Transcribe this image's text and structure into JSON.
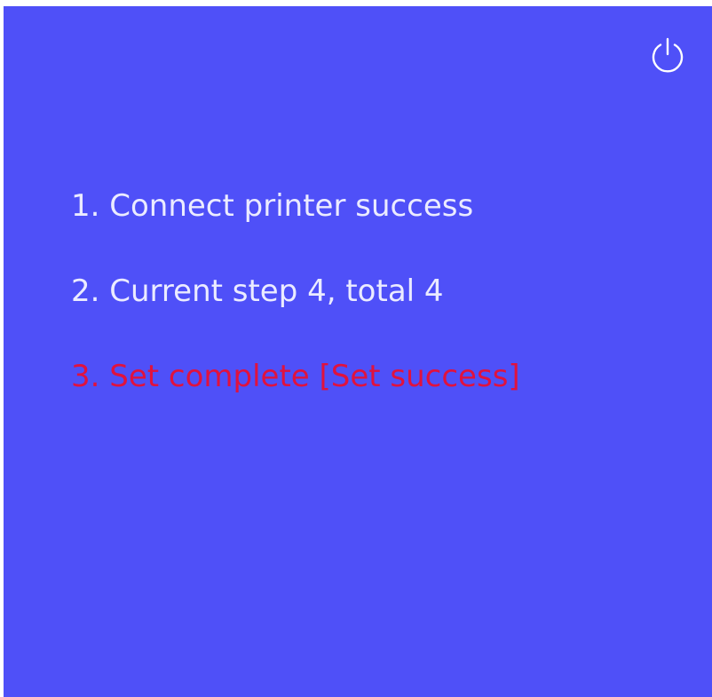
{
  "power_button": {
    "icon": "power-icon",
    "color": "#ffffff"
  },
  "steps": [
    {
      "text": "1. Connect printer success",
      "color": "#ebebff"
    },
    {
      "text": "2. Current step 4, total 4",
      "color": "#ebebff"
    },
    {
      "text": "3. Set complete [Set success]",
      "color": "#e0123e"
    }
  ],
  "colors": {
    "background": "#4f50f8",
    "text": "#ebebff",
    "highlight": "#e0123e"
  }
}
